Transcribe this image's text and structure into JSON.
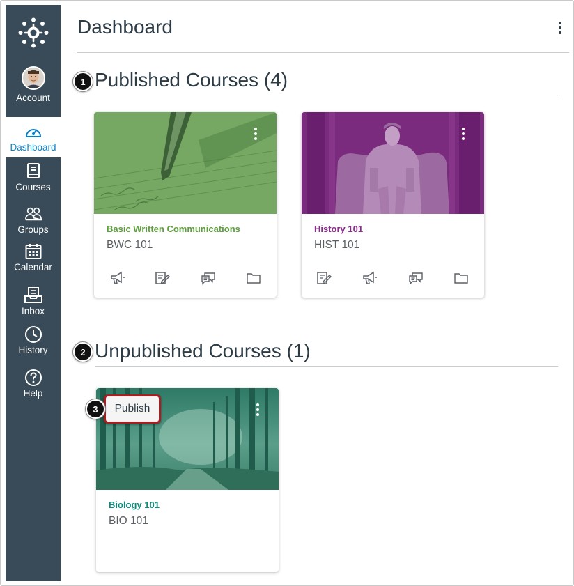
{
  "nav": {
    "items": [
      {
        "label": "Account",
        "icon": "account-avatar"
      },
      {
        "label": "Dashboard",
        "icon": "dashboard-icon",
        "active": true
      },
      {
        "label": "Courses",
        "icon": "courses-icon"
      },
      {
        "label": "Groups",
        "icon": "groups-icon"
      },
      {
        "label": "Calendar",
        "icon": "calendar-icon"
      },
      {
        "label": "Inbox",
        "icon": "inbox-icon"
      },
      {
        "label": "History",
        "icon": "history-icon"
      },
      {
        "label": "Help",
        "icon": "help-icon"
      }
    ]
  },
  "header": {
    "title": "Dashboard"
  },
  "sections": {
    "published": {
      "title": "Published Courses (4)",
      "step": "1"
    },
    "unpublished": {
      "title": "Unpublished Courses (1)",
      "step": "2"
    }
  },
  "cards": [
    {
      "name": "Basic Written Communications",
      "code": "BWC 101",
      "name_color": "#5d9e3f",
      "hero_color": "#6b9f59",
      "actions": [
        "announcements-icon",
        "assignments-icon",
        "discussions-icon",
        "files-icon"
      ]
    },
    {
      "name": "History 101",
      "code": "HIST 101",
      "name_color": "#8a2c8a",
      "hero_color": "#7a2b7d",
      "actions": [
        "assignments-icon",
        "announcements-icon",
        "discussions-icon",
        "files-icon"
      ]
    },
    {
      "name": "Biology 101",
      "code": "BIO 101",
      "name_color": "#0f8a7a",
      "hero_color": "#2c7f6b",
      "actions": []
    }
  ],
  "publish": {
    "label": "Publish",
    "step": "3"
  },
  "colors": {
    "nav_bg": "#394b58",
    "active_link": "#0a7fc6",
    "publish_border": "#a51f22"
  }
}
